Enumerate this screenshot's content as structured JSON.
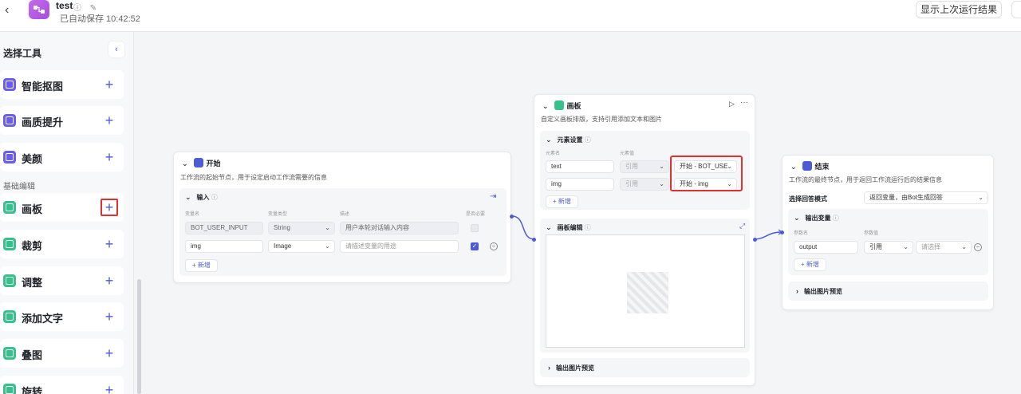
{
  "header": {
    "back_icon": "‹",
    "title": "test",
    "autosave": "已自动保存 10:42:52",
    "run_result_button": "显示上次运行结果"
  },
  "sidebar": {
    "title": "选择工具",
    "collapse_icon": "‹",
    "section_label": "基础编辑",
    "items": [
      {
        "label": "智能抠图",
        "icon": "purple"
      },
      {
        "label": "画质提升",
        "icon": "purple"
      },
      {
        "label": "美颜",
        "icon": "purple"
      },
      {
        "label": "画板",
        "icon": "green"
      },
      {
        "label": "裁剪",
        "icon": "green"
      },
      {
        "label": "调整",
        "icon": "green"
      },
      {
        "label": "添加文字",
        "icon": "green"
      },
      {
        "label": "叠图",
        "icon": "green"
      },
      {
        "label": "旋转",
        "icon": "green"
      }
    ],
    "plus": "+"
  },
  "start_node": {
    "title": "开始",
    "desc": "工作流的起始节点，用于设定启动工作流需要的信息",
    "input_title": "输入",
    "col_name": "变量名",
    "col_type": "变量类型",
    "col_desc": "描述",
    "col_required": "是否必要",
    "rows": [
      {
        "name": "BOT_USER_INPUT",
        "type": "String",
        "desc": "用户本轮对话输入内容",
        "required": false
      },
      {
        "name": "img",
        "type": "Image",
        "desc": "请描述变量的用途",
        "required": true
      }
    ],
    "add_label": "+ 新增"
  },
  "canvas_node": {
    "title": "画板",
    "desc": "自定义画板排版，支持引用添加文本和图片",
    "elements_title": "元素设置",
    "col_name": "元素名",
    "col_value": "元素值",
    "rows": [
      {
        "name": "text",
        "mode": "引用",
        "value": "开始 - BOT_USE"
      },
      {
        "name": "img",
        "mode": "引用",
        "value": "开始 - img"
      }
    ],
    "add_label": "+ 新增",
    "edit_title": "画板编辑",
    "preview_title": "输出图片预览"
  },
  "end_node": {
    "title": "结束",
    "desc": "工作流的最终节点，用于返回工作流运行后的结果信息",
    "mode_label": "选择回答模式",
    "mode_value": "返回变量，由Bot生成回答",
    "output_title": "输出变量",
    "col_name": "参数名",
    "col_value": "参数值",
    "row": {
      "name": "output",
      "mode": "引用",
      "value": "请选择"
    },
    "add_label": "+ 新增",
    "preview_title": "输出图片预览"
  },
  "colors": {
    "accent": "#4e5bd6",
    "highlight": "#e03131",
    "canvas_node": "#34c28a"
  }
}
